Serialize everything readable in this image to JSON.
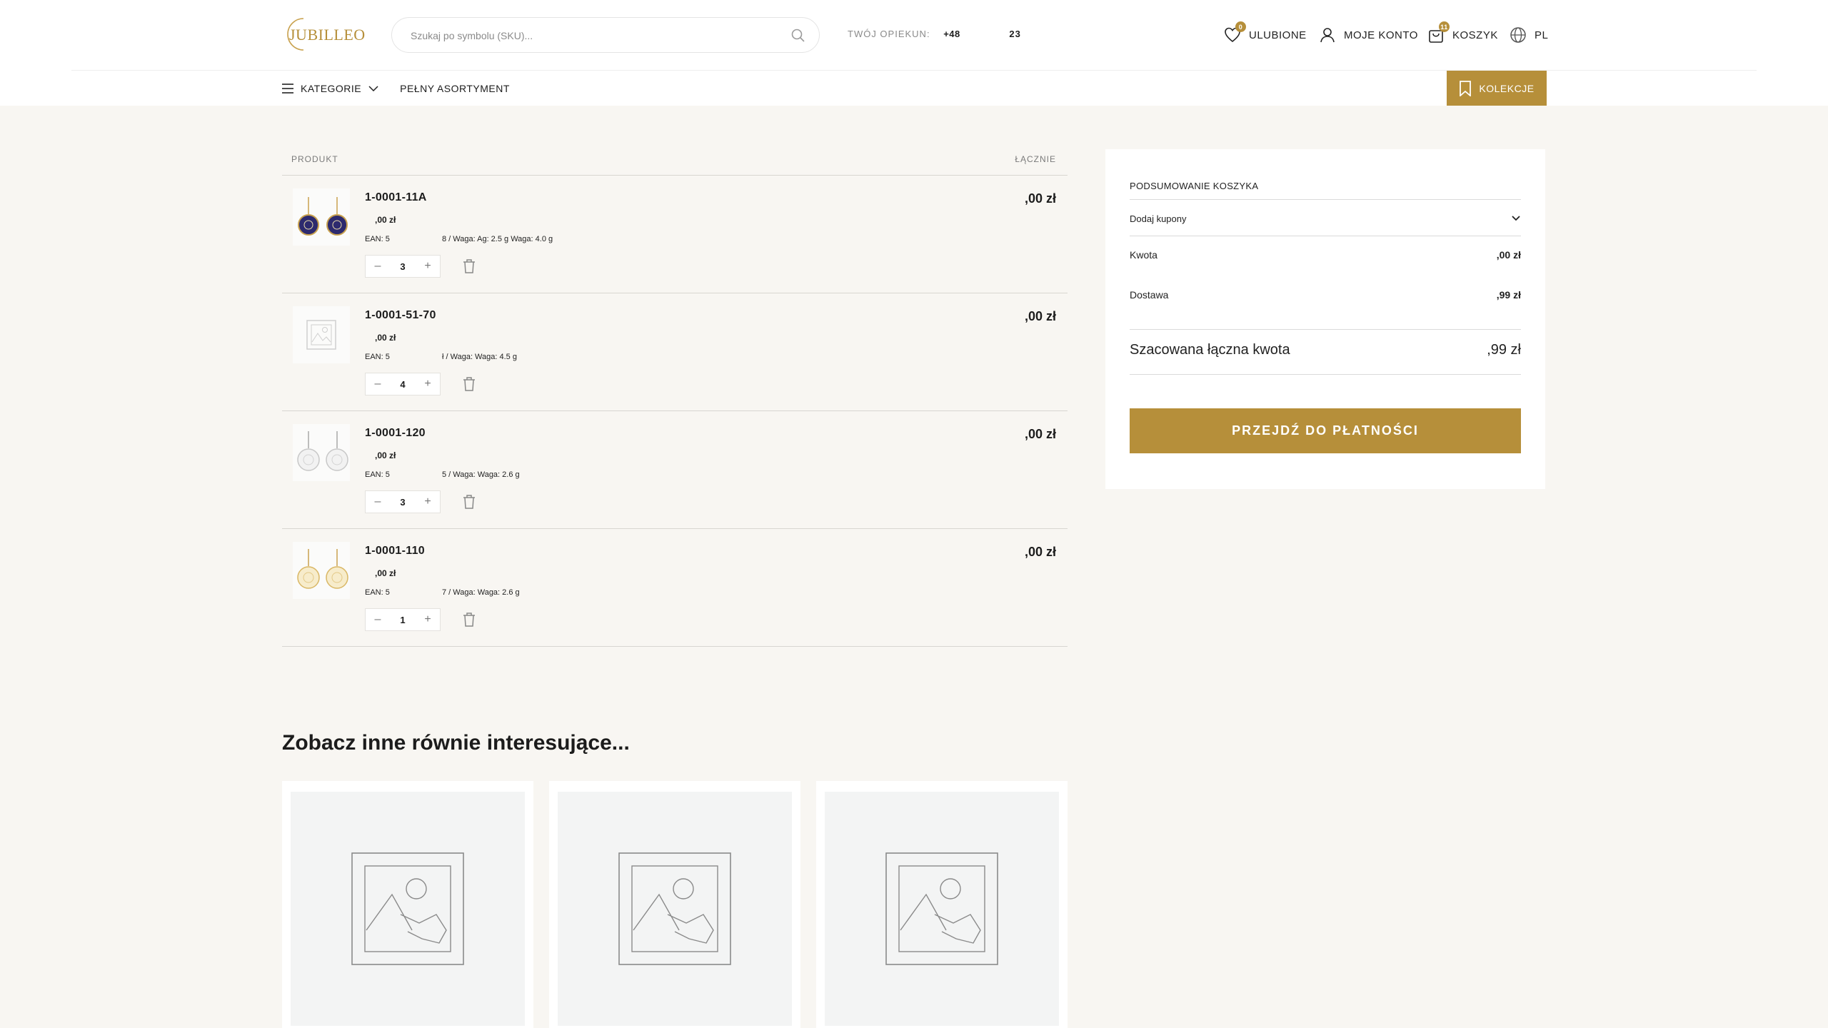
{
  "header": {
    "logo_text": "JUBILLEO",
    "search_placeholder": "Szukaj po symbolu (SKU)...",
    "opiekun_label": "TWÓJ OPIEKUN:",
    "opiekun_phone": "+48",
    "opiekun_phone_tail": "23",
    "favorites": {
      "label": "ULUBIONE",
      "badge": "0",
      "icon": "heart-icon"
    },
    "account": {
      "label": "MOJE KONTO",
      "icon": "user-icon"
    },
    "cart": {
      "label": "KOSZYK",
      "badge": "11",
      "icon": "bag-icon"
    },
    "language": {
      "label": "PL",
      "icon": "globe-icon"
    }
  },
  "menu": {
    "categories_label": "KATEGORIE",
    "full_range_label": "PEŁNY ASORTYMENT",
    "collections_label": "KOLEKCJE"
  },
  "cart": {
    "col_product": "PRODUKT",
    "col_total": "ŁĄCZNIE",
    "items": [
      {
        "name": "1-0001-11A",
        "price": ",00 zł",
        "ean": "EAN: 5",
        "meta": "8 / Waga: Ag: 2.5 g Waga: 4.0 g",
        "qty": "3",
        "total": ",00 zł",
        "thumb": "navy-earrings"
      },
      {
        "name": "1-0001-51-70",
        "price": ",00 zł",
        "ean": "EAN: 5",
        "meta": "ł / Waga: Waga: 4.5 g",
        "qty": "4",
        "total": ",00 zł",
        "thumb": "placeholder"
      },
      {
        "name": "1-0001-120",
        "price": ",00 zł",
        "ean": "EAN: 5",
        "meta": "5 / Waga: Waga: 2.6 g",
        "qty": "3",
        "total": ",00 zł",
        "thumb": "silver-earrings"
      },
      {
        "name": "1-0001-110",
        "price": ",00 zł",
        "ean": "EAN: 5",
        "meta": "7 / Waga: Waga: 2.6 g",
        "qty": "1",
        "total": ",00 zł",
        "thumb": "gold-earrings"
      }
    ],
    "minus": "–",
    "plus": "+"
  },
  "summary": {
    "title": "PODSUMOWANIE KOSZYKA",
    "coupon_label": "Dodaj kupony",
    "amount_label": "Kwota",
    "amount_value": ",00 zł",
    "delivery_label": "Dostawa",
    "delivery_value": ",99 zł",
    "total_label": "Szacowana łączna kwota",
    "total_value": ",99 zł",
    "pay_button": "PRZEJDŹ DO PŁATNOŚCI"
  },
  "recommendations": {
    "title": "Zobacz inne równie interesujące...",
    "cards": [
      {
        "image": "placeholder"
      },
      {
        "image": "placeholder"
      },
      {
        "image": "placeholder"
      }
    ]
  },
  "colors": {
    "accent": "#b68f3a",
    "background": "#f8f6f2",
    "navy": "#2d2a6e"
  }
}
